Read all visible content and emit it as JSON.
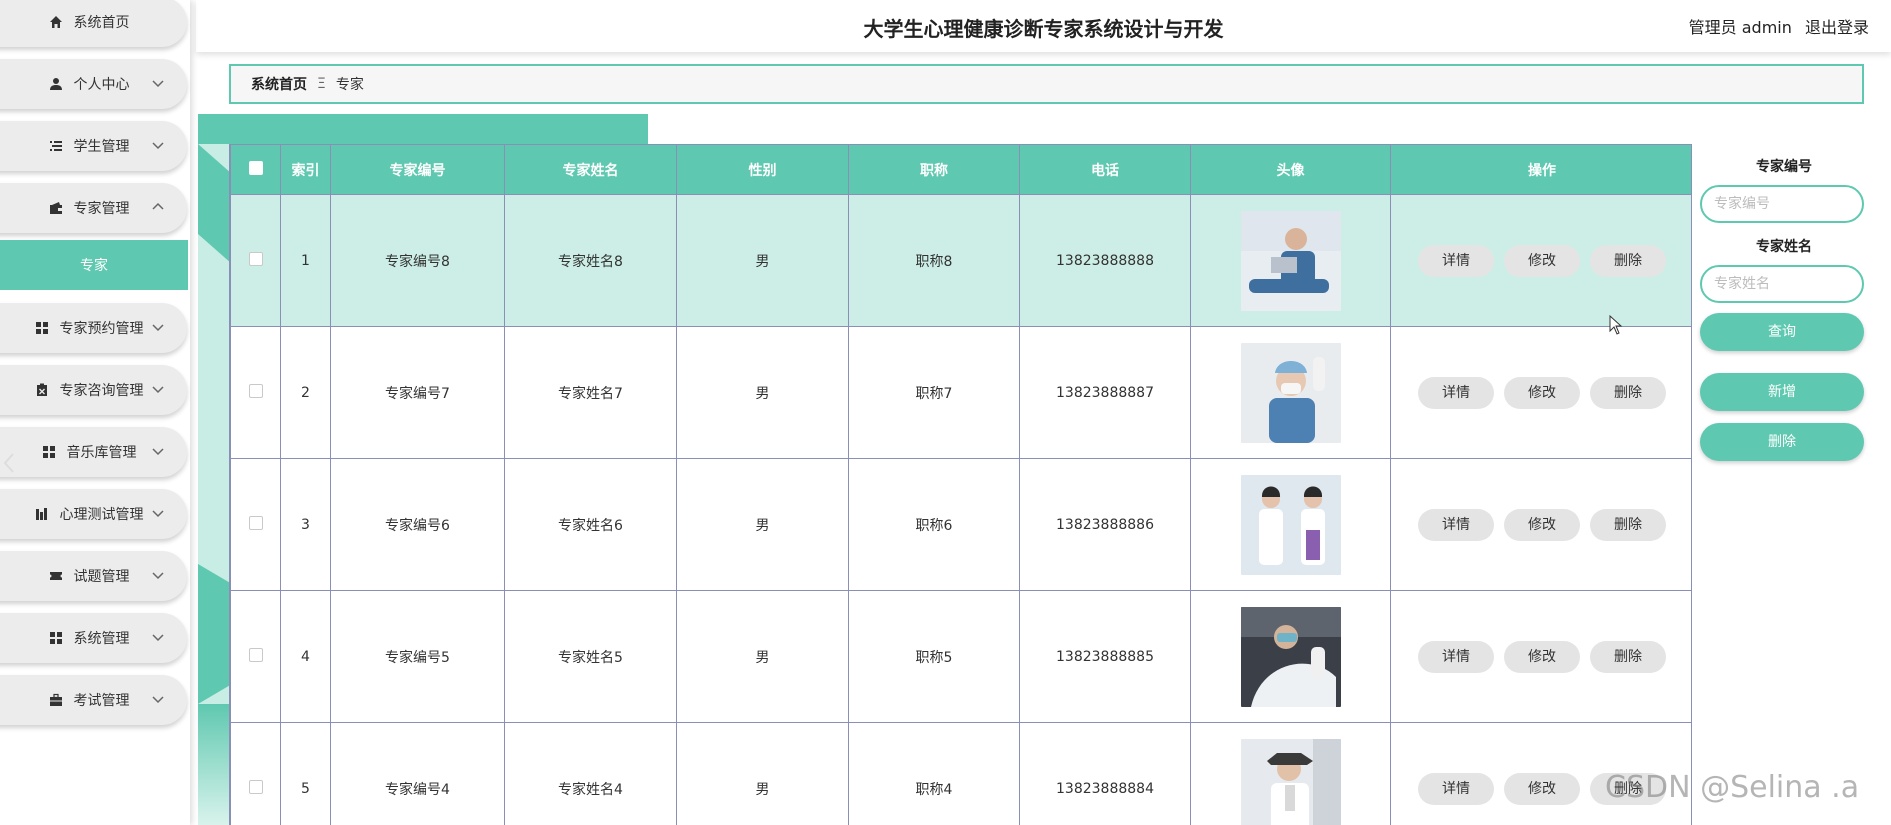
{
  "header": {
    "title": "大学生心理健康诊断专家系统设计与开发",
    "admin_label": "管理员 admin",
    "logout_label": "退出登录"
  },
  "sidebar": {
    "items": [
      {
        "label": "系统首页",
        "icon": "home-icon"
      },
      {
        "label": "个人中心",
        "icon": "user-icon"
      },
      {
        "label": "学生管理",
        "icon": "list-icon"
      },
      {
        "label": "专家管理",
        "icon": "wallet-icon"
      },
      {
        "label": "专家预约管理",
        "icon": "grid-icon"
      },
      {
        "label": "专家咨询管理",
        "icon": "clipboard-icon"
      },
      {
        "label": "音乐库管理",
        "icon": "grid-icon"
      },
      {
        "label": "心理测试管理",
        "icon": "chart-icon"
      },
      {
        "label": "试题管理",
        "icon": "ticket-icon"
      },
      {
        "label": "系统管理",
        "icon": "grid-icon"
      },
      {
        "label": "考试管理",
        "icon": "briefcase-icon"
      }
    ],
    "sub_item": "专家"
  },
  "breadcrumb": {
    "home": "系统首页",
    "separator": "Ξ",
    "current": "专家"
  },
  "table": {
    "headers": [
      "索引",
      "专家编号",
      "专家姓名",
      "性别",
      "职称",
      "电话",
      "头像",
      "操作"
    ],
    "rows": [
      {
        "index": "1",
        "code": "专家编号8",
        "name": "专家姓名8",
        "gender": "男",
        "title": "职称8",
        "phone": "13823888888",
        "selected": true
      },
      {
        "index": "2",
        "code": "专家编号7",
        "name": "专家姓名7",
        "gender": "男",
        "title": "职称7",
        "phone": "13823888887",
        "selected": false
      },
      {
        "index": "3",
        "code": "专家编号6",
        "name": "专家姓名6",
        "gender": "男",
        "title": "职称6",
        "phone": "13823888886",
        "selected": false
      },
      {
        "index": "4",
        "code": "专家编号5",
        "name": "专家姓名5",
        "gender": "男",
        "title": "职称5",
        "phone": "13823888885",
        "selected": false
      },
      {
        "index": "5",
        "code": "专家编号4",
        "name": "专家姓名4",
        "gender": "男",
        "title": "职称4",
        "phone": "13823888884",
        "selected": false
      }
    ],
    "actions": {
      "detail": "详情",
      "edit": "修改",
      "delete": "删除"
    }
  },
  "search": {
    "code_label": "专家编号",
    "code_placeholder": "专家编号",
    "name_label": "专家姓名",
    "name_placeholder": "专家姓名",
    "query_button": "查询",
    "add_button": "新增",
    "delete_button": "删除"
  },
  "watermark": "CSDN @Selina .a",
  "colors": {
    "accent": "#5fc8b0",
    "selected_row": "#cdeee6",
    "grid_line": "#8a8fb8",
    "nav_bg": "#ececec"
  }
}
